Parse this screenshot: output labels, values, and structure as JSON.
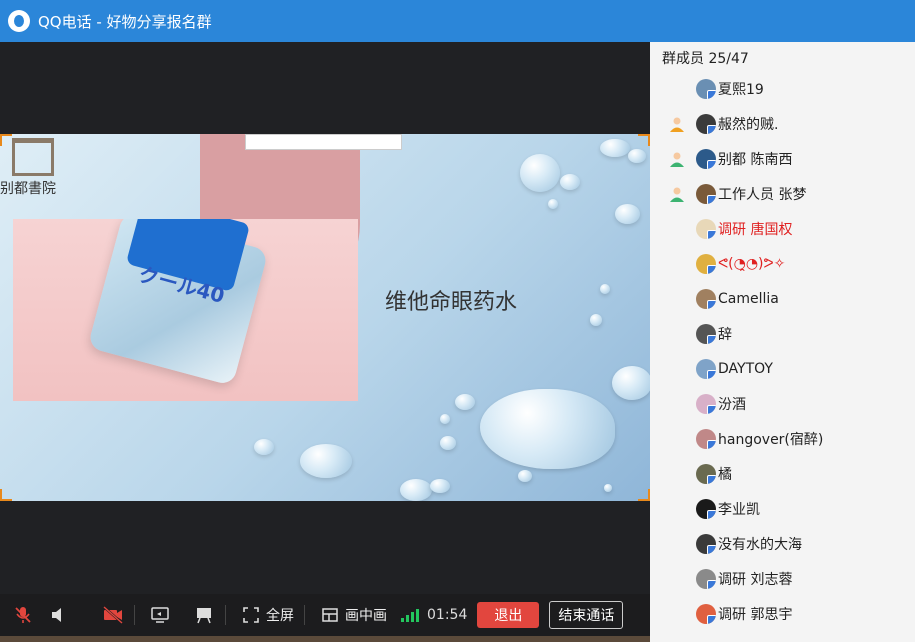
{
  "window": {
    "title": "QQ电话 - 好物分享报名群"
  },
  "slide": {
    "heading": "维他命眼药水",
    "brand_text": "クール40",
    "logo_text": "别都書院"
  },
  "controls": {
    "fullscreen_label": "全屏",
    "pip_label": "画中画",
    "timer": "01:54",
    "exit_label": "退出",
    "end_call_label": "结束通话"
  },
  "members": {
    "count": "群成员 25/47",
    "items": [
      {
        "name": "夏熙19",
        "role": "none",
        "color": "#222",
        "avatar_color": "#6a8fb3"
      },
      {
        "name": "赧然的贼.",
        "role": "owner",
        "color": "#222",
        "avatar_color": "#3b3b3b"
      },
      {
        "name": "别都 陈南西",
        "role": "admin",
        "color": "#222",
        "avatar_color": "#2c5a8a"
      },
      {
        "name": "工作人员  张梦",
        "role": "admin",
        "color": "#222",
        "avatar_color": "#7a5a3a"
      },
      {
        "name": "调研 唐国权",
        "role": "none",
        "color": "#e02020",
        "avatar_color": "#e8d8b8"
      },
      {
        "name": "ᕙ(◔̯◔)ᕗ✧",
        "role": "none",
        "color": "#e02020",
        "avatar_color": "#e0b040"
      },
      {
        "name": "Camellia",
        "role": "none",
        "color": "#222",
        "avatar_color": "#a08060"
      },
      {
        "name": "辞",
        "role": "none",
        "color": "#222",
        "avatar_color": "#555"
      },
      {
        "name": "DAYTOY",
        "role": "none",
        "color": "#222",
        "avatar_color": "#7fa3c8"
      },
      {
        "name": "汾酒",
        "role": "none",
        "color": "#222",
        "avatar_color": "#d8b0c8"
      },
      {
        "name": "hangover(宿醉)",
        "role": "none",
        "color": "#222",
        "avatar_color": "#c08888"
      },
      {
        "name": "橘",
        "role": "none",
        "color": "#222",
        "avatar_color": "#6a6a50"
      },
      {
        "name": "李业凯",
        "role": "none",
        "color": "#222",
        "avatar_color": "#1a1a1a"
      },
      {
        "name": "没有水的大海",
        "role": "none",
        "color": "#222",
        "avatar_color": "#3a3a3a"
      },
      {
        "name": "调研  刘志蓉",
        "role": "none",
        "color": "#222",
        "avatar_color": "#8a8a8a"
      },
      {
        "name": "调研 郭思宇",
        "role": "none",
        "color": "#222",
        "avatar_color": "#e06040"
      }
    ]
  },
  "colors": {
    "titlebar": "#2b86d9",
    "exit_button": "#e2463e",
    "signal": "#23c55e",
    "accent_corner": "#e8891c"
  }
}
